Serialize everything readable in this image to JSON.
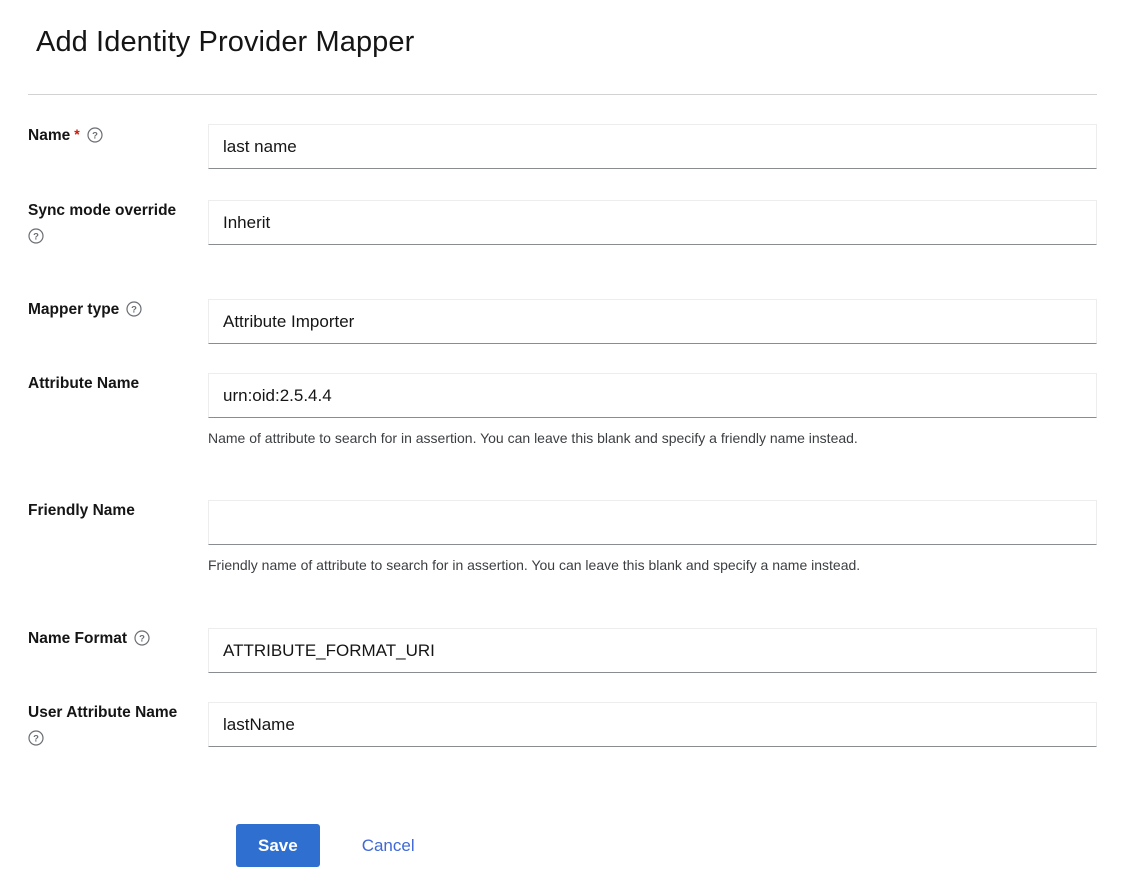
{
  "header": {
    "title": "Add Identity Provider Mapper"
  },
  "form": {
    "fields": [
      {
        "id": "name",
        "label": "Name",
        "required": true,
        "required_marker": "*",
        "help_icon": "help-circle-icon",
        "help_icon_position": "inline",
        "value": "last name",
        "placeholder": "",
        "helper_text": ""
      },
      {
        "id": "sync-mode-override",
        "label": "Sync mode override",
        "required": false,
        "required_marker": "",
        "help_icon": "help-circle-icon",
        "help_icon_position": "below",
        "value": "Inherit",
        "placeholder": "",
        "helper_text": ""
      },
      {
        "id": "mapper-type",
        "label": "Mapper type",
        "required": false,
        "required_marker": "",
        "help_icon": "help-circle-icon",
        "help_icon_position": "inline",
        "value": "Attribute Importer",
        "placeholder": "",
        "helper_text": ""
      },
      {
        "id": "attribute-name",
        "label": "Attribute Name",
        "required": false,
        "required_marker": "",
        "help_icon": "",
        "help_icon_position": "none",
        "value": "urn:oid:2.5.4.4",
        "placeholder": "",
        "helper_text": "Name of attribute to search for in assertion. You can leave this blank and specify a friendly name instead."
      },
      {
        "id": "friendly-name",
        "label": "Friendly Name",
        "required": false,
        "required_marker": "",
        "help_icon": "",
        "help_icon_position": "none",
        "value": "",
        "placeholder": "",
        "helper_text": "Friendly name of attribute to search for in assertion. You can leave this blank and specify a name instead."
      },
      {
        "id": "name-format",
        "label": "Name Format",
        "required": false,
        "required_marker": "",
        "help_icon": "help-circle-icon",
        "help_icon_position": "inline",
        "value": "ATTRIBUTE_FORMAT_URI",
        "placeholder": "",
        "helper_text": ""
      },
      {
        "id": "user-attribute-name",
        "label": "User Attribute Name",
        "required": false,
        "required_marker": "",
        "help_icon": "help-circle-icon",
        "help_icon_position": "below",
        "value": "lastName",
        "placeholder": "",
        "helper_text": ""
      }
    ]
  },
  "actions": {
    "save_label": "Save",
    "cancel_label": "Cancel"
  },
  "colors": {
    "primary_button": "#2f6fd0",
    "link": "#4169d6",
    "required_marker": "#c9190b",
    "input_underline": "#8a8d90",
    "divider": "#d2d2d2"
  }
}
